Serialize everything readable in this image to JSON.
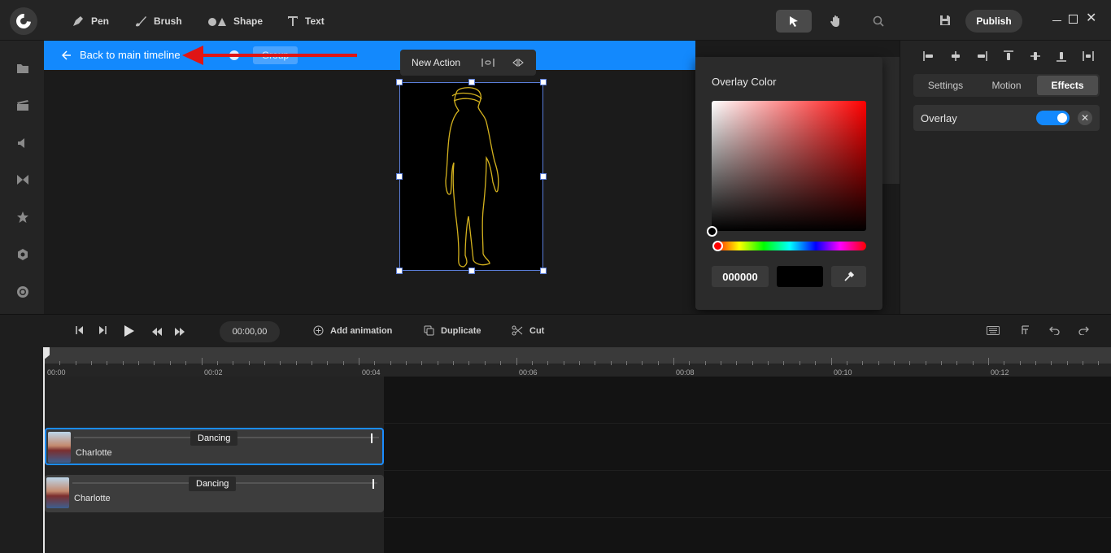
{
  "toolbar": {
    "tools": [
      {
        "label": "Pen",
        "icon": "pen-icon"
      },
      {
        "label": "Brush",
        "icon": "brush-icon"
      },
      {
        "label": "Shape",
        "icon": "shape-icon"
      },
      {
        "label": "Text",
        "icon": "text-icon"
      }
    ],
    "publish_label": "Publish"
  },
  "sidebar": {
    "icons": [
      "folder-icon",
      "media-icon",
      "audio-icon",
      "transition-icon",
      "star-icon",
      "element-icon",
      "record-icon"
    ]
  },
  "group_bar": {
    "back_label": "Back to main timeline",
    "group_label": "Group",
    "bg_color": "#1389fd"
  },
  "action_bar": {
    "label": "New Action"
  },
  "color_popup": {
    "title": "Overlay Color",
    "hex_value": "000000",
    "hue_color": "#ff0000"
  },
  "right_panel": {
    "tabs": [
      {
        "label": "Settings",
        "active": false
      },
      {
        "label": "Motion",
        "active": false
      },
      {
        "label": "Effects",
        "active": true
      }
    ],
    "overlay": {
      "label": "Overlay",
      "enabled": true
    }
  },
  "timeline": {
    "current_time": "00:00,00",
    "add_animation_label": "Add animation",
    "duplicate_label": "Duplicate",
    "cut_label": "Cut",
    "ticks": [
      "00:00",
      "00:02",
      "00:04",
      "00:06",
      "00:08",
      "00:10",
      "00:12"
    ],
    "clips": [
      {
        "name": "Charlotte",
        "action": "Dancing",
        "selected": true
      },
      {
        "name": "Charlotte",
        "action": "Dancing",
        "selected": false
      }
    ]
  }
}
